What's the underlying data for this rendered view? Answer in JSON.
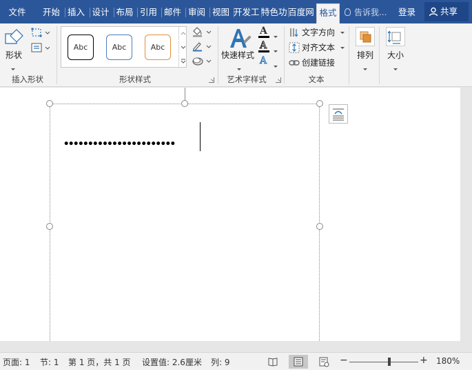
{
  "tabs": [
    {
      "label": "文件"
    },
    {
      "label": "开始"
    },
    {
      "label": "插入"
    },
    {
      "label": "设计"
    },
    {
      "label": "布局"
    },
    {
      "label": "引用"
    },
    {
      "label": "邮件"
    },
    {
      "label": "审阅"
    },
    {
      "label": "视图"
    },
    {
      "label": "开发工"
    },
    {
      "label": "特色功"
    },
    {
      "label": "百度网"
    },
    {
      "label": "格式"
    }
  ],
  "active_tab": "格式",
  "tell_me": "告诉我...",
  "login": "登录",
  "share": "共享",
  "ribbon": {
    "insert_shapes": {
      "shape_button": "形状",
      "group_label": "插入形状"
    },
    "shape_styles": {
      "preset_label": "Abc",
      "preset_border_colors": [
        "#000000",
        "#4a7ebb",
        "#e0913a"
      ],
      "group_label": "形状样式"
    },
    "wordart": {
      "quick_styles": "快速样式",
      "text_fill_glyph": "A",
      "text_outline_glyph": "A",
      "text_effects_glyph": "A",
      "group_label": "艺术字样式"
    },
    "text": {
      "text_direction": "文字方向",
      "align_text": "对齐文本",
      "create_link": "创建链接",
      "group_label": "文本"
    },
    "arrange": "排列",
    "size": "大小"
  },
  "document": {
    "dotted_text": "•••••••••••••••••••••••"
  },
  "status": {
    "page": "页面: 1",
    "section": "节: 1",
    "page_of": "第 1 页，共 1 页",
    "setting": "设置值: 2.6厘米",
    "column": "列: 9",
    "zoom_minus": "−",
    "zoom_plus": "+",
    "zoom": "180%"
  },
  "colors": {
    "title_bar": "#2b579a",
    "ribbon_bg": "#f3f3f3",
    "wordart_blue": "#2e75b6",
    "accent_orange": "#e0913a"
  }
}
